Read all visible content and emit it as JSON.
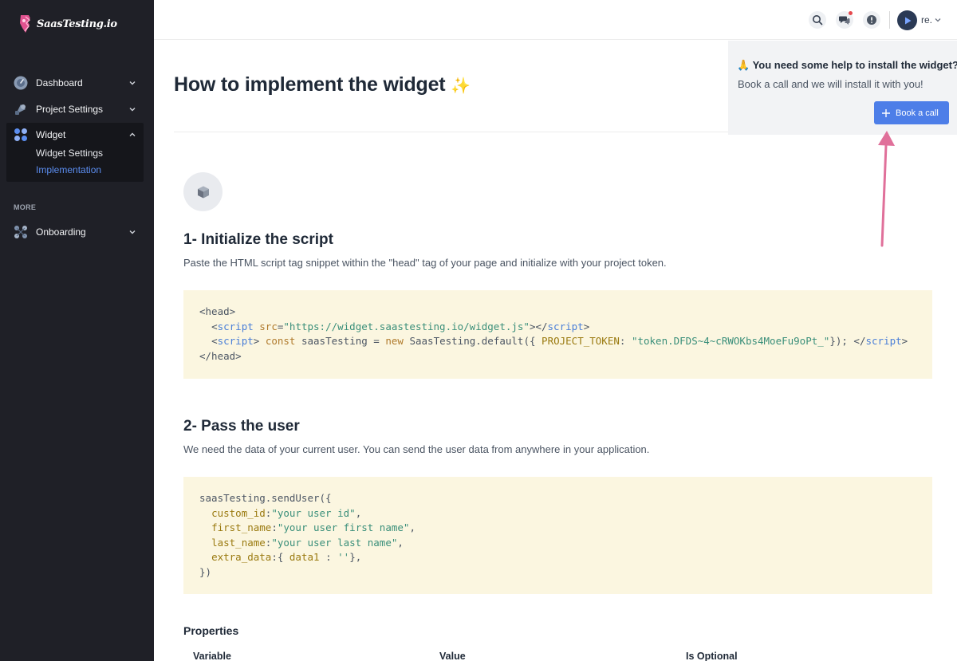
{
  "app": {
    "logo_text": "SaasTesting.io",
    "accent": "#4d7ee8",
    "sidebar_bg": "#1f2027"
  },
  "sidebar": {
    "items": [
      {
        "label": "Dashboard",
        "icon": "dashboard-icon",
        "expanded": false
      },
      {
        "label": "Project Settings",
        "icon": "settings-icon",
        "expanded": false
      },
      {
        "label": "Widget",
        "icon": "widget-icon",
        "expanded": true,
        "children": [
          {
            "label": "Widget Settings",
            "active": false
          },
          {
            "label": "Implementation",
            "active": true
          }
        ]
      }
    ],
    "section_more": "MORE",
    "more_items": [
      {
        "label": "Onboarding",
        "icon": "onboarding-icon",
        "expanded": false
      }
    ]
  },
  "topbar": {
    "icons": [
      "search-icon",
      "chat-icon",
      "alert-icon"
    ],
    "user_name": "re."
  },
  "help": {
    "emoji": "🙏",
    "title": "You need some help to install the widget?",
    "text": "Book a call and we will install it with you!",
    "button_label": "Book a call"
  },
  "main": {
    "title": "How to implement the widget",
    "title_emoji": "✨",
    "step1": {
      "heading": "1- Initialize the script",
      "description": "Paste the HTML script tag snippet within the \"head\" tag of your page and initialize with your project token.",
      "code": {
        "head_open": "<head>",
        "head_close": "</head>",
        "script_tag": "script",
        "src_attr": "src",
        "src_value": "\"https://widget.saastesting.io/widget.js\"",
        "line2_const": "const",
        "line2_var": "saasTesting",
        "line2_new": "new",
        "line2_class": "SaasTesting.default({",
        "token_key": "PROJECT_TOKEN",
        "token_value": "\"token.DFDS~4~cRWOKbs4MoeFu9oPt_\"",
        "line2_end": "});"
      }
    },
    "step2": {
      "heading": "2- Pass the user",
      "description": "We need the data of your current user. You can send the user data from anywhere in your application.",
      "code": {
        "call": "saasTesting.sendUser({",
        "fields": [
          {
            "key": "custom_id",
            "value": "\"your user id\""
          },
          {
            "key": "first_name",
            "value": "\"your user first name\""
          },
          {
            "key": "last_name",
            "value": "\"your user last name\""
          }
        ],
        "extra_key": "extra_data",
        "extra_inner_key": "data1",
        "extra_inner_value": "''",
        "close": "})"
      }
    },
    "properties": {
      "title": "Properties",
      "columns": [
        "Variable",
        "Value",
        "Is Optional"
      ]
    }
  }
}
